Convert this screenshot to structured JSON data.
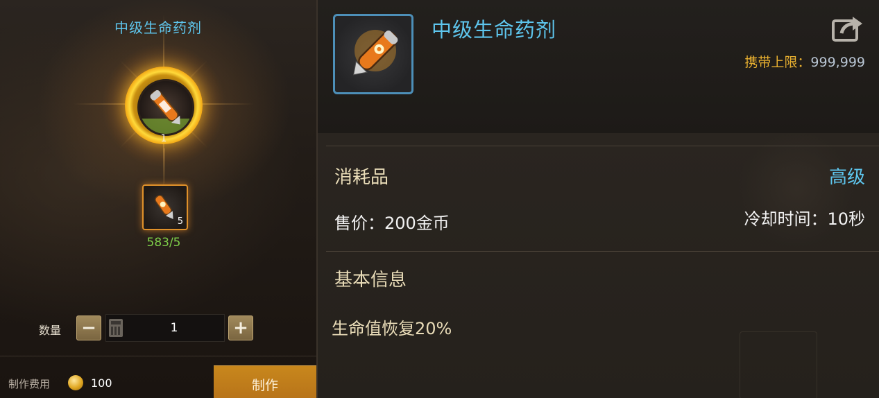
{
  "left_panel": {
    "recipe_title": "中级生命药剂",
    "product_count": "1",
    "product_icon": "orange-potion-vial-icon",
    "material_icon": "orange-potion-shard-icon",
    "material_qty": "5",
    "material_progress": "583/5",
    "quantity_label": "数量",
    "quantity_value": "1",
    "minus_label": "−",
    "plus_label": "+",
    "cost_label": "制作费用",
    "cost_value": "100",
    "craft_button": "制作"
  },
  "item_detail": {
    "title": "中级生命药剂",
    "carry_limit_label": "携带上限：",
    "carry_limit_value": "999,999",
    "category": "消耗品",
    "grade": "高级",
    "sell_price": "售价：200金币",
    "cooldown": "冷却时间：10秒",
    "basic_info_heading": "基本信息",
    "effect": "生命值恢复20%"
  },
  "colors": {
    "title_blue": "#5ec6ee",
    "gold_label": "#e8b030",
    "progress_green": "#7fd14a",
    "craft_button_orange": "#c8871c",
    "item_frame_blue": "#4d8fb8"
  }
}
